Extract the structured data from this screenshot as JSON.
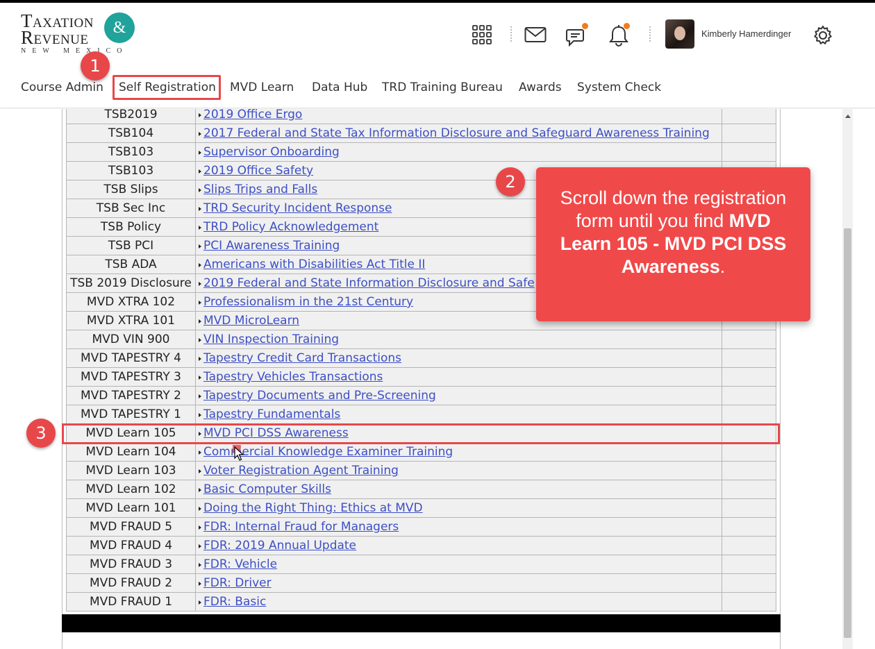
{
  "logo": {
    "line1": "Taxation",
    "line2": "Revenue",
    "amp": "&",
    "line3": "NEW MEXICO"
  },
  "header": {
    "icons": [
      "apps-grid-icon",
      "mail-icon",
      "chat-icon",
      "bell-icon",
      "gear-icon"
    ],
    "user_name": "Kimberly Hamerdinger",
    "notification_color": "#f07c1e"
  },
  "nav": {
    "items": [
      "Course Admin",
      "Self Registration",
      "MVD Learn",
      "Data Hub",
      "TRD Training Bureau",
      "Awards",
      "System Check"
    ]
  },
  "table": {
    "rows": [
      {
        "code": "TSB2019",
        "title": "2019 Office Ergo"
      },
      {
        "code": "TSB104",
        "title": "2017 Federal and State Tax Information Disclosure and Safeguard Awareness Training"
      },
      {
        "code": "TSB103",
        "title": "Supervisor Onboarding"
      },
      {
        "code": "TSB103",
        "title": "2019 Office Safety"
      },
      {
        "code": "TSB Slips",
        "title": "Slips Trips and Falls"
      },
      {
        "code": "TSB Sec Inc",
        "title": "TRD Security Incident Response"
      },
      {
        "code": "TSB Policy",
        "title": "TRD Policy Acknowledgement"
      },
      {
        "code": "TSB PCI",
        "title": "PCI Awareness Training"
      },
      {
        "code": "TSB ADA",
        "title": "Americans with Disabilities Act Title II"
      },
      {
        "code": "TSB 2019 Disclosure",
        "title": "2019 Federal and State Information Disclosure and Safe"
      },
      {
        "code": "MVD XTRA 102",
        "title": "Professionalism in the 21st Century"
      },
      {
        "code": "MVD XTRA 101",
        "title": "MVD MicroLearn"
      },
      {
        "code": "MVD VIN 900",
        "title": "VIN Inspection Training"
      },
      {
        "code": "MVD TAPESTRY 4",
        "title": "Tapestry Credit Card Transactions"
      },
      {
        "code": "MVD TAPESTRY 3",
        "title": "Tapestry Vehicles Transactions"
      },
      {
        "code": "MVD TAPESTRY 2",
        "title": "Tapestry Documents and Pre-Screening"
      },
      {
        "code": "MVD TAPESTRY 1",
        "title": "Tapestry Fundamentals"
      },
      {
        "code": "MVD Learn 105",
        "title": "MVD PCI DSS Awareness"
      },
      {
        "code": "MVD Learn 104",
        "title": "Commercial Knowledge Examiner Training"
      },
      {
        "code": "MVD Learn 103",
        "title": "Voter Registration Agent Training"
      },
      {
        "code": "MVD Learn 102",
        "title": "Basic Computer Skills"
      },
      {
        "code": "MVD Learn 101",
        "title": "Doing the Right Thing: Ethics at MVD"
      },
      {
        "code": "MVD FRAUD 5",
        "title": "FDR: Internal Fraud for Managers"
      },
      {
        "code": "MVD FRAUD 4",
        "title": "FDR: 2019 Annual Update"
      },
      {
        "code": "MVD FRAUD 3",
        "title": "FDR: Vehicle"
      },
      {
        "code": "MVD FRAUD 2",
        "title": "FDR: Driver"
      },
      {
        "code": "MVD FRAUD 1",
        "title": "FDR: Basic"
      }
    ]
  },
  "annotations": {
    "badge1": "1",
    "badge2": "2",
    "badge3": "3",
    "callout_pre": "Scroll down the registration form until you find ",
    "callout_bold": "MVD Learn 105 - MVD PCI DSS Awareness",
    "callout_post": ".",
    "accent_color": "#e8474a"
  }
}
